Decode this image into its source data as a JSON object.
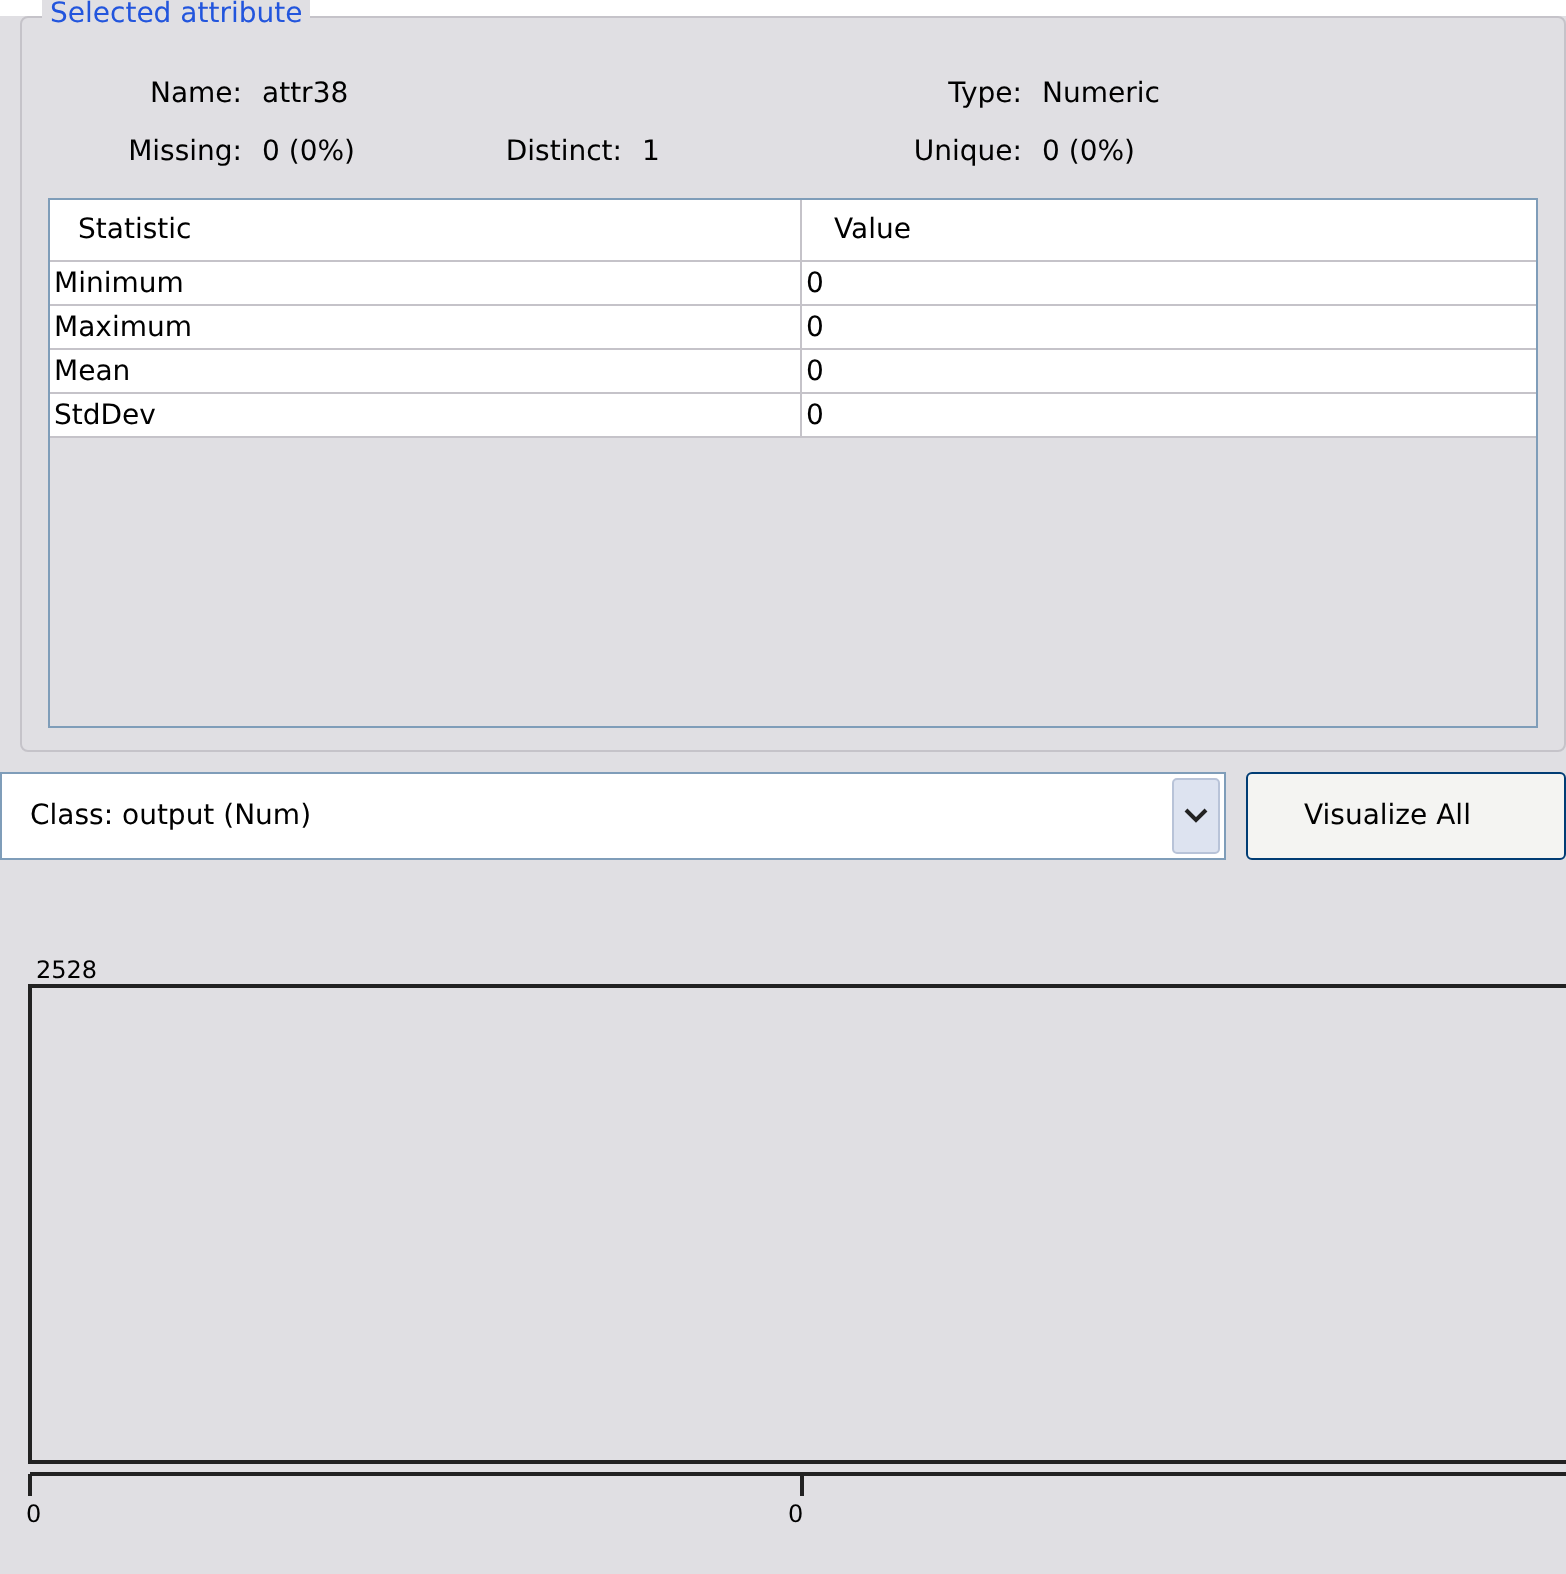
{
  "group_title": "Selected attribute",
  "info": [
    {
      "label": "Name:",
      "value": "attr38"
    },
    {
      "label": "Type:",
      "value": "Numeric"
    },
    {
      "label": "Missing:",
      "value": "0 (0%)"
    },
    {
      "label": "Distinct:",
      "value": "1"
    },
    {
      "label": "Unique:",
      "value": "0 (0%)"
    }
  ],
  "table": {
    "columns": [
      "Statistic",
      "Value"
    ],
    "rows": [
      [
        "Minimum",
        "0"
      ],
      [
        "Maximum",
        "0"
      ],
      [
        "Mean",
        "0"
      ],
      [
        "StdDev",
        "0"
      ]
    ]
  },
  "class_select": {
    "value": "Class: output (Num)"
  },
  "visualize_button": "Visualize All",
  "histogram": {
    "max_label": "2528",
    "axis_labels": [
      "0",
      "0"
    ]
  }
}
